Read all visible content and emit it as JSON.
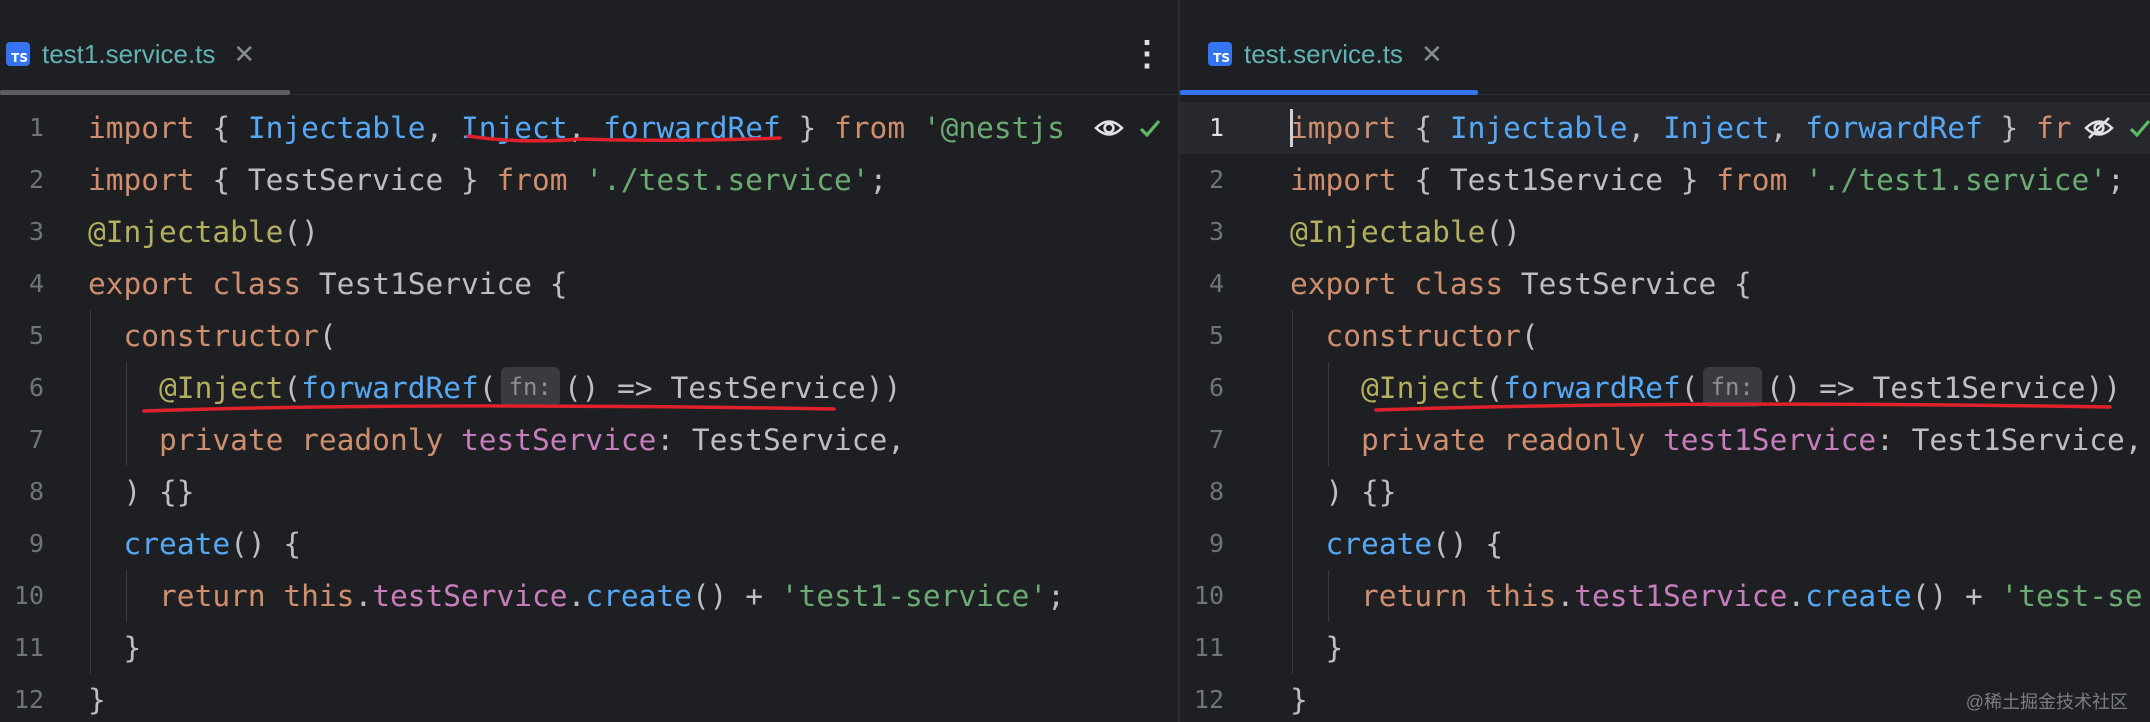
{
  "left": {
    "tab": {
      "label": "test1.service.ts",
      "icon": "typescript-file-icon"
    },
    "line_numbers": [
      "1",
      "2",
      "3",
      "4",
      "5",
      "6",
      "7",
      "8",
      "9",
      "10",
      "11",
      "12"
    ],
    "lines": [
      [
        "import",
        " { ",
        "Injectable",
        ", ",
        "Inject",
        ", ",
        "forwardRef",
        " } ",
        "from",
        " ",
        "'@nestjs"
      ],
      [
        "import",
        " { TestService } ",
        "from",
        " ",
        "'./test.service'",
        ";"
      ],
      [
        "@Injectable",
        "()"
      ],
      [
        "export",
        " ",
        "class",
        " Test1Service {"
      ],
      [
        "  ",
        "constructor",
        "("
      ],
      [
        "    ",
        "@Inject",
        "(",
        "forwardRef",
        "(",
        "fn:",
        "() => TestService))"
      ],
      [
        "    ",
        "private",
        " ",
        "readonly",
        " ",
        "testService",
        ": TestService,"
      ],
      [
        "  ) {}"
      ],
      [
        "  ",
        "create",
        "() {"
      ],
      [
        "    ",
        "return",
        " ",
        "this",
        ".",
        "testService",
        ".",
        "create",
        "() + ",
        "'test1-service'",
        ";"
      ],
      [
        "  }"
      ],
      [
        "}"
      ]
    ]
  },
  "right": {
    "tab": {
      "label": "test.service.ts",
      "icon": "typescript-file-icon"
    },
    "line_numbers": [
      "1",
      "2",
      "3",
      "4",
      "5",
      "6",
      "7",
      "8",
      "9",
      "10",
      "11",
      "12"
    ],
    "lines": [
      [
        "import",
        " { ",
        "Injectable",
        ", ",
        "Inject",
        ", ",
        "forwardRef",
        " } ",
        "fr"
      ],
      [
        "import",
        " { Test1Service } ",
        "from",
        " ",
        "'./test1.service'",
        ";"
      ],
      [
        "@Injectable",
        "()"
      ],
      [
        "export",
        " ",
        "class",
        " TestService {"
      ],
      [
        "  ",
        "constructor",
        "("
      ],
      [
        "    ",
        "@Inject",
        "(",
        "forwardRef",
        "(",
        "fn:",
        "() => Test1Service))"
      ],
      [
        "    ",
        "private",
        " ",
        "readonly",
        " ",
        "test1Service",
        ": Test1Service,"
      ],
      [
        "  ) {}"
      ],
      [
        "  ",
        "create",
        "() {"
      ],
      [
        "    ",
        "return",
        " ",
        "this",
        ".",
        "test1Service",
        ".",
        "create",
        "() + ",
        "'test-se"
      ],
      [
        "  }"
      ],
      [
        "}"
      ]
    ]
  },
  "icons": {
    "more": "more-vertical-icon",
    "close": "close-icon",
    "eye": "eye-icon",
    "eye_off": "eye-off-icon",
    "check": "check-icon"
  },
  "watermark": "@稀土掘金技术社区",
  "colors": {
    "background": "#1e1f22",
    "keyword": "#cf8e6d",
    "function": "#56a8f5",
    "string": "#6aab73",
    "decorator": "#b3ae60",
    "field": "#c77dbb",
    "tab_underline": "#3574f0",
    "annotation": "#e0202a",
    "check": "#5fb865"
  }
}
